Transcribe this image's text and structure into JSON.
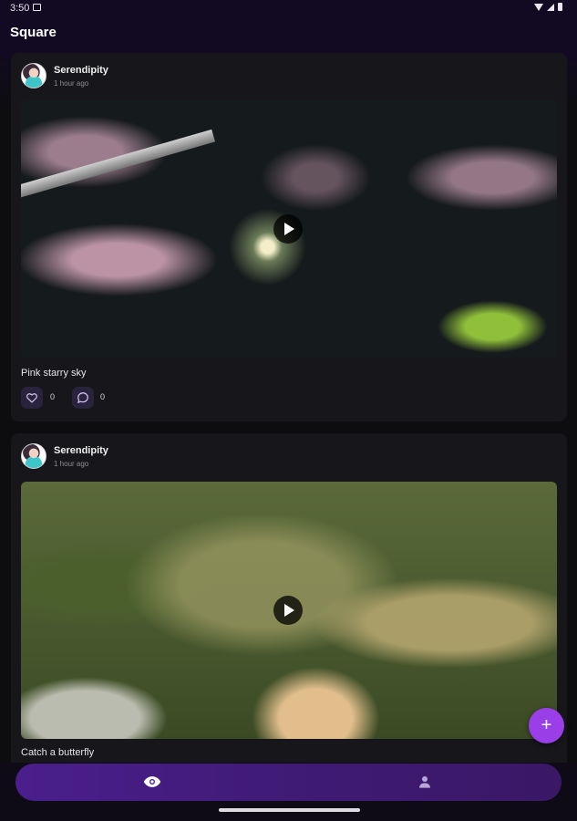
{
  "status_bar": {
    "time": "3:50"
  },
  "app_bar": {
    "title": "Square"
  },
  "posts": [
    {
      "username": "Serendipity",
      "time_ago": "1 hour ago",
      "caption": "Pink starry sky",
      "likes": "0",
      "comments": "0"
    },
    {
      "username": "Serendipity",
      "time_ago": "1 hour ago",
      "caption": "Catch a butterfly"
    }
  ],
  "fab": {
    "label": "+"
  },
  "colors": {
    "accent": "#9a3ee8",
    "nav": "#4a1e8c",
    "card": "#17171b"
  },
  "bottom_nav": {
    "items": [
      "eye-icon",
      "person-icon"
    ]
  }
}
